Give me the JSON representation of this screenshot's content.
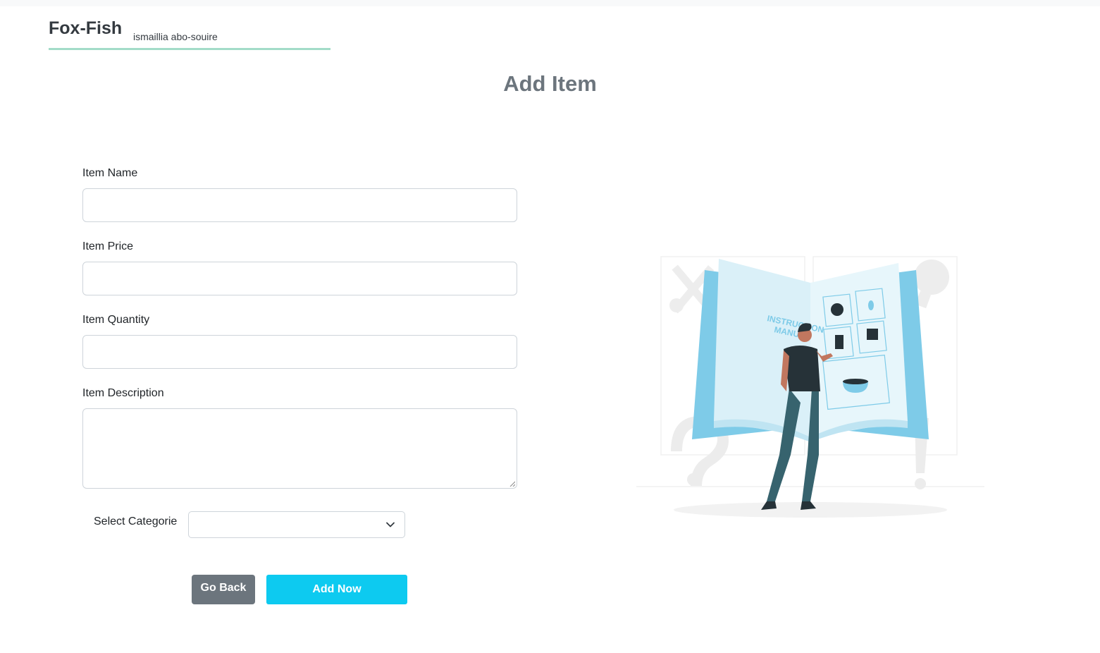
{
  "header": {
    "brand": "Fox-Fish",
    "location": "ismaillia abo-souire"
  },
  "page": {
    "title": "Add Item"
  },
  "form": {
    "item_name_label": "Item Name",
    "item_name_value": "",
    "item_price_label": "Item Price",
    "item_price_value": "",
    "item_quantity_label": "Item Quantity",
    "item_quantity_value": "",
    "item_description_label": "Item Description",
    "item_description_value": "",
    "category_label": "Select Categorie",
    "category_selected": "",
    "go_back_label": "Go Back",
    "add_now_label": "Add Now"
  },
  "illustration": {
    "book_text_line1": "INSTRUCTION",
    "book_text_line2": "MANUAL"
  },
  "colors": {
    "brand_underline": "#a3dcc8",
    "title": "#6c757d",
    "go_back_button": "#6c757d",
    "add_now_button": "#0dcaf0",
    "illustration_accent": "#7ecbe8"
  },
  "icons": {
    "category_select": "chevron-down-icon",
    "textarea_resize": "resize-grip-icon"
  }
}
